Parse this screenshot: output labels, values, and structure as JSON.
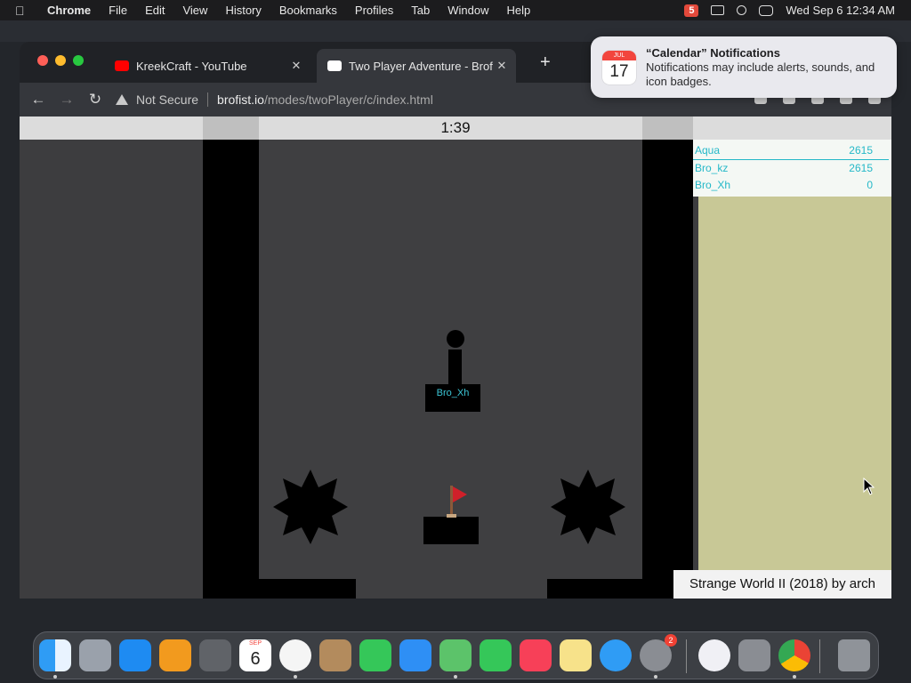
{
  "menubar": {
    "app": "Chrome",
    "items": [
      "File",
      "Edit",
      "View",
      "History",
      "Bookmarks",
      "Profiles",
      "Tab",
      "Window",
      "Help"
    ],
    "clock": "Wed Sep 6  12:34 AM",
    "status_icons": [
      "s5-icon",
      "screen-mirroring-icon",
      "search-icon",
      "control-center-icon"
    ]
  },
  "tabs": [
    {
      "title": "KreekCraft - YouTube",
      "favicon": "youtube-icon"
    },
    {
      "title": "Two Player Adventure - Brofist",
      "favicon": "brofist-icon",
      "active": true
    }
  ],
  "toolbar": {
    "security_label": "Not Secure",
    "url_host": "brofist.io",
    "url_path": "/modes/twoPlayer/c/index.html"
  },
  "game": {
    "timer": "1:39",
    "player_label": "Bro_Xh",
    "scores": [
      {
        "name": "Aqua",
        "score": "2615"
      },
      {
        "name": "Bro_kz",
        "score": "2615"
      },
      {
        "name": "Bro_Xh",
        "score": "0"
      }
    ],
    "credit": "Strange World II (2018) by arch",
    "colors": {
      "wall": "#000000",
      "panel": "#c8c896",
      "score_text": "#24b8c8",
      "flag": "#d0202a"
    }
  },
  "notification": {
    "title": "“Calendar” Notifications",
    "body": "Notifications may include alerts, sounds, and icon badges.",
    "icon_month": "JUL",
    "icon_day": "17"
  },
  "dock": {
    "calendar_month": "SEP",
    "calendar_day": "6",
    "settings_badge": "2",
    "apps": [
      "finder-icon",
      "launchpad-icon",
      "app-store-icon",
      "books-icon",
      "calculator-icon",
      "calendar-icon",
      "clock-icon",
      "contacts-icon",
      "facetime-icon",
      "mail-icon",
      "maps-icon",
      "messages-icon",
      "music-icon",
      "notes-icon",
      "safari-icon",
      "system-settings-icon",
      "settings-gear-icon",
      "dictionary-icon",
      "chrome-icon",
      "trash-icon"
    ]
  }
}
